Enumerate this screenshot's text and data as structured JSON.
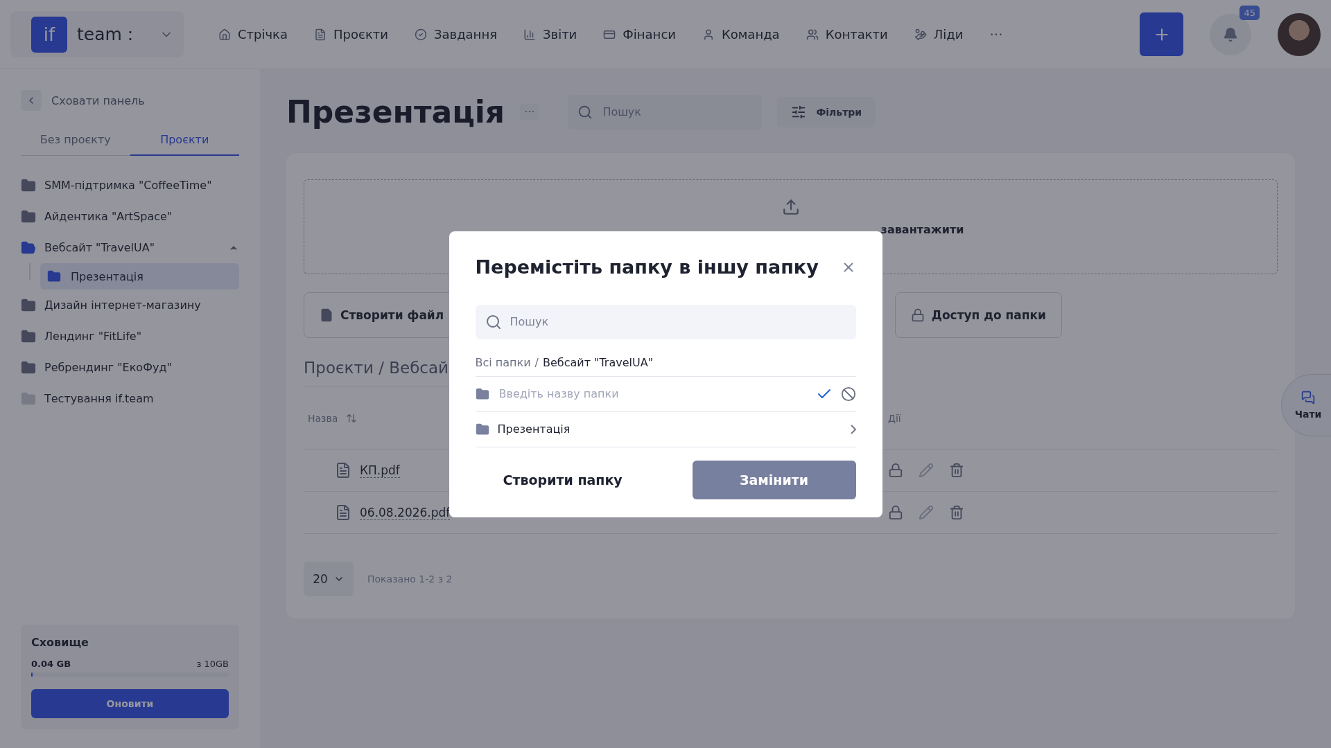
{
  "top_bar": {
    "logo": "if",
    "workspace": "team :",
    "nav": [
      {
        "label": "Стрічка"
      },
      {
        "label": "Проєкти"
      },
      {
        "label": "Завдання"
      },
      {
        "label": "Звіти"
      },
      {
        "label": "Фінанси"
      },
      {
        "label": "Команда"
      },
      {
        "label": "Контакти"
      },
      {
        "label": "Ліди"
      }
    ],
    "more": "···",
    "notifications": "45"
  },
  "sidebar": {
    "hide_panel": "Сховати панель",
    "tabs": [
      {
        "label": "Без проєкту",
        "selected": false
      },
      {
        "label": "Проєкти",
        "selected": true
      }
    ],
    "folders": [
      {
        "name": "SMM-підтримка \"CoffeeTime\"",
        "expanded": false,
        "dimmed": false
      },
      {
        "name": "Айдентика \"ArtSpace\"",
        "expanded": false,
        "dimmed": false
      },
      {
        "name": "Вебсайт \"TravelUA\"",
        "expanded": true,
        "dimmed": false,
        "children": [
          {
            "name": "Презентація",
            "selected": true
          }
        ]
      },
      {
        "name": "Дизайн інтернет-магазину",
        "expanded": false,
        "dimmed": false
      },
      {
        "name": "Лендинг \"FitLife\"",
        "expanded": false,
        "dimmed": false
      },
      {
        "name": "Ребрендинг \"ЕкоФуд\"",
        "expanded": false,
        "dimmed": false
      },
      {
        "name": "Тестування if.team",
        "expanded": false,
        "dimmed": true
      }
    ],
    "storage": {
      "title": "Сховище",
      "used": "0.04 GB",
      "total": "з 10GB",
      "level": 0.004,
      "button": "Оновити"
    }
  },
  "main": {
    "title": "Презентація",
    "more": "···",
    "search": {
      "placeholder": "Пошук"
    },
    "filters": "Фільтри",
    "upload_text": "завантажити",
    "buttons": [
      "Створити файл",
      "Доступ до папки"
    ],
    "breadcrumb": "Проєкти / Вебсай",
    "columns": [
      "Назва",
      "Дії"
    ],
    "files": [
      {
        "name": "КП.pdf"
      },
      {
        "name": "06.08.2026.pdf"
      }
    ],
    "page_size": "20",
    "shown": "Показано 1-2 з 2"
  },
  "chats": "Чати",
  "modal": {
    "title": "Перемістіть папку в іншу папку",
    "search": {
      "placeholder": "Пошук"
    },
    "breadcrumb": {
      "root": "Всі папки",
      "separator": "/",
      "current": "Вебсайт \"TravelUA\""
    },
    "new_folder": {
      "placeholder": "Введіть назву папки"
    },
    "folders": [
      {
        "name": "Презентація"
      }
    ],
    "create_button": "Створити папку",
    "replace_button": "Замінити"
  }
}
